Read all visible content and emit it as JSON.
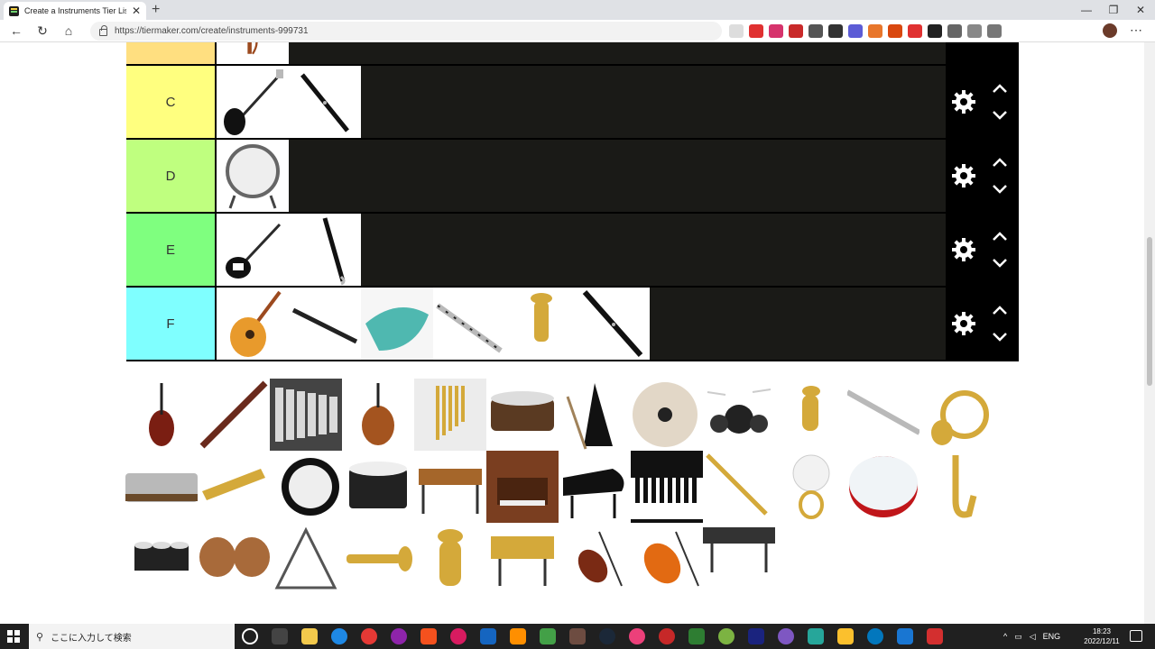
{
  "browser": {
    "tab_title": "Create a Instruments Tier List - T",
    "tab_close": "✕",
    "new_tab": "+",
    "url": "https://tiermaker.com/create/instruments-999731",
    "window_controls": [
      "—",
      "❐",
      "✕"
    ]
  },
  "tiers": [
    {
      "label": "",
      "color": "#ffdf80",
      "items": [
        "harp"
      ]
    },
    {
      "label": "C",
      "color": "#ffff7f",
      "items": [
        "bass-guitar",
        "oboe"
      ]
    },
    {
      "label": "D",
      "color": "#bfff7f",
      "items": [
        "concert-bass-drum"
      ]
    },
    {
      "label": "E",
      "color": "#7fff7f",
      "items": [
        "electric-guitar",
        "bass-clarinet"
      ]
    },
    {
      "label": "F",
      "color": "#7fffff",
      "items": [
        "acoustic-guitar",
        "bassoon-piece",
        "ocarina",
        "flute-piece",
        "baritone-horn",
        "clarinet"
      ]
    }
  ],
  "pool": [
    "double-bass",
    "bassoon",
    "glockenspiel",
    "viola",
    "chimes",
    "snare-drum",
    "metronome",
    "cymbals",
    "drum-kit",
    "euphonium",
    "flute",
    "french-horn",
    "harmonica",
    "kazoo",
    "marching-bass-drum",
    "marching-snare",
    "marimba",
    "pipe-organ",
    "grand-piano",
    "keyboard",
    "soprano-sax",
    "sousaphone",
    "tambourine",
    "alto-sax",
    "tenor-drums",
    "timpani",
    "triangle",
    "trumpet",
    "tuba",
    "vibraphone",
    "violin",
    "violin-orange",
    "xylophone"
  ],
  "taskbar": {
    "search_placeholder": "ここに入力して検索",
    "lang": "ENG",
    "time": "18:23",
    "date": "2022/12/11"
  },
  "colors": {
    "tier_bg": "#1a1a17",
    "ctrl_bg": "#000000",
    "taskbar": "#202020"
  }
}
